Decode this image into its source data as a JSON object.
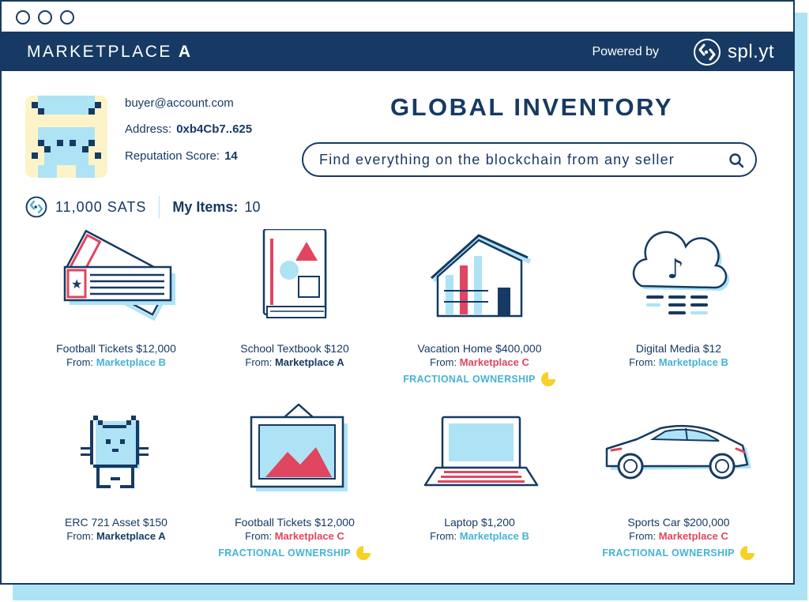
{
  "window": {
    "dots": [
      "window-dot-1",
      "window-dot-2",
      "window-dot-3"
    ]
  },
  "header": {
    "brand": "MARKETPLACE",
    "brand_letter": "A",
    "powered_by": "Powered by",
    "splyt_name": "spl.yt"
  },
  "account": {
    "email": "buyer@account.com",
    "address_label": "Address:",
    "address_value": "0xb4Cb7..625",
    "reputation_label": "Reputation Score:",
    "reputation_value": "14"
  },
  "title": "GLOBAL INVENTORY",
  "search": {
    "placeholder": "Find everything on the blockchain from any seller"
  },
  "balance": {
    "sats": "11,000 SATS",
    "my_items_label": "My Items:",
    "my_items_count": "10"
  },
  "colors": {
    "navy": "#163a63",
    "light_blue": "#aee3f5",
    "blue": "#45b3d6",
    "red": "#e0465f",
    "yellow": "#f7d02c"
  },
  "items": [
    {
      "icon": "tickets-icon",
      "name": "Football Tickets $12,000",
      "from_label": "From:",
      "from": "Marketplace B"
    },
    {
      "icon": "textbook-icon",
      "name": "School Textbook $120",
      "from_label": "From:",
      "from": "Marketplace A"
    },
    {
      "icon": "house-icon",
      "name": "Vacation Home $400,000",
      "from_label": "From:",
      "from": "Marketplace C",
      "fractional": "FRACTIONAL OWNERSHIP"
    },
    {
      "icon": "cloud-music-icon",
      "name": "Digital Media $12",
      "from_label": "From:",
      "from": "Marketplace B"
    },
    {
      "icon": "pixel-cat-icon",
      "name": "ERC 721 Asset $150",
      "from_label": "From:",
      "from": "Marketplace A"
    },
    {
      "icon": "framed-picture-icon",
      "name": "Football Tickets $12,000",
      "from_label": "From:",
      "from": "Marketplace C",
      "fractional": "FRACTIONAL OWNERSHIP"
    },
    {
      "icon": "laptop-icon",
      "name": "Laptop $1,200",
      "from_label": "From:",
      "from": "Marketplace B"
    },
    {
      "icon": "sports-car-icon",
      "name": "Sports Car $200,000",
      "from_label": "From:",
      "from": "Marketplace C",
      "fractional": "FRACTIONAL OWNERSHIP"
    }
  ]
}
